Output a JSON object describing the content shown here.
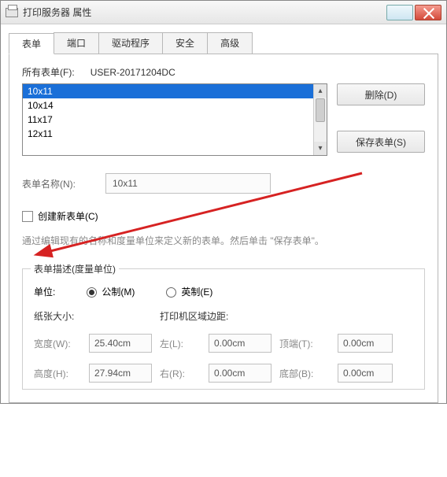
{
  "window": {
    "title": "打印服务器 属性"
  },
  "tabs": [
    "表单",
    "端口",
    "驱动程序",
    "安全",
    "高级"
  ],
  "activeTab": 0,
  "allFormsLabel": "所有表单(F):",
  "serverName": "USER-20171204DC",
  "formList": [
    "10x11",
    "10x14",
    "11x17",
    "12x11"
  ],
  "selectedIndex": 0,
  "buttons": {
    "delete": "删除(D)",
    "saveForm": "保存表单(S)"
  },
  "formNameLabel": "表单名称(N):",
  "formNameValue": "10x11",
  "createNew": {
    "label": "创建新表单(C)",
    "checked": false
  },
  "helpText": "通过编辑现有的名称和度量单位来定义新的表单。然后单击 \"保存表单\"。",
  "descLegend": "表单描述(度量单位)",
  "unitLabel": "单位:",
  "unitMetric": "公制(M)",
  "unitEnglish": "英制(E)",
  "unitSelected": "metric",
  "paperSizeLabel": "纸张大小:",
  "marginsLabel": "打印机区域边距:",
  "dims": {
    "widthLabel": "宽度(W):",
    "width": "25.40cm",
    "heightLabel": "高度(H):",
    "height": "27.94cm",
    "leftLabel": "左(L):",
    "left": "0.00cm",
    "rightLabel": "右(R):",
    "right": "0.00cm",
    "topLabel": "顶端(T):",
    "top": "0.00cm",
    "bottomLabel": "底部(B):",
    "bottom": "0.00cm"
  }
}
